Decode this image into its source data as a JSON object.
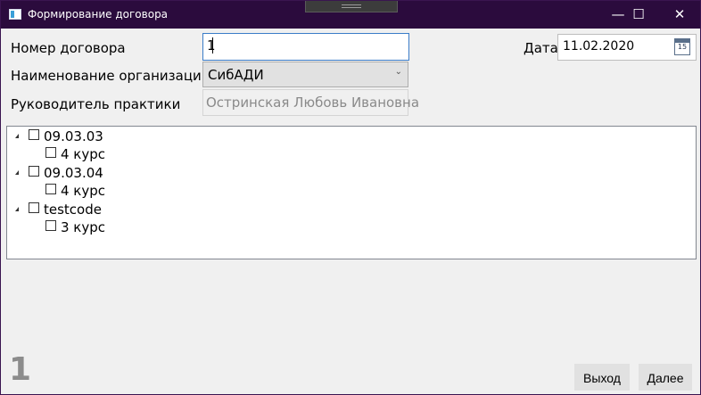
{
  "window": {
    "title": "Формирование договора"
  },
  "title_buttons": {
    "minimize": "—",
    "maximize": "☐",
    "close": "✕"
  },
  "form": {
    "contract_number_label": "Номер договора",
    "contract_number_value": "1",
    "organization_label": "Наименование организации",
    "organization_value": "СибАДИ",
    "supervisor_label": "Руководитель практики",
    "supervisor_value": "Остринская Любовь Ивановна",
    "date_label": "Дата",
    "date_value": "11.02.2020",
    "calendar_day": "15"
  },
  "tree": [
    {
      "label": "09.03.03",
      "children": [
        {
          "label": "4 курс"
        }
      ]
    },
    {
      "label": "09.03.04",
      "children": [
        {
          "label": "4 курс"
        }
      ]
    },
    {
      "label": "testcode",
      "children": [
        {
          "label": "3 курс"
        }
      ]
    }
  ],
  "footer": {
    "counter": "1",
    "exit_label": "Выход",
    "next_label": "Далее"
  }
}
